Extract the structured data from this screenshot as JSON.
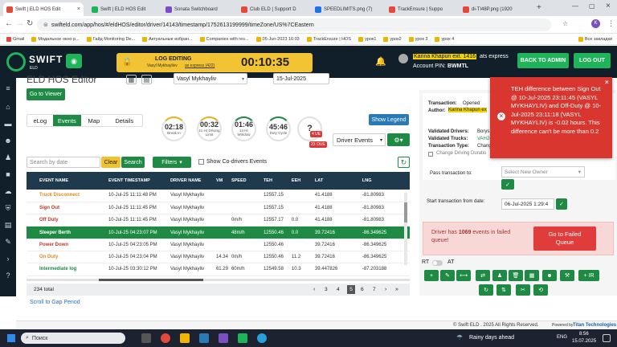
{
  "browser": {
    "tabs": [
      {
        "label": "Swift | ELD HOS Edit",
        "color": "#e24b3b",
        "active": true
      },
      {
        "label": "Swift | ELD HOS Edit",
        "color": "#1fb35a"
      },
      {
        "label": "Sonata Switchboard",
        "color": "#7b4bc9"
      },
      {
        "label": "Club ELD | Support D",
        "color": "#e24b3b"
      },
      {
        "label": "SPEEDLIMITS.png (7)",
        "color": "#1a73e8"
      },
      {
        "label": "TrackEnsure | Suppo",
        "color": "#e24b3b"
      },
      {
        "label": "di-TI48P.png (1920",
        "color": "#e24b3b"
      }
    ],
    "url": "swifteld.com/app/hos/#/eldHOS/editor/driver/14143/timestamp/1752613199999/timeZone/US%7CEastern",
    "bookmarks": [
      "Gmail",
      "Модальное окно р...",
      "Гайд Monitoring De...",
      "Актуальные избран...",
      "Companies with res...",
      "05-Jun-2023 16:03",
      "TrackEnsure | HOS",
      "урок1",
      "урок2",
      "урок 3",
      "урок 4",
      "Все закладки"
    ]
  },
  "header": {
    "brand": "SWIFT",
    "brand_sub": "ELD",
    "log_editing_title": "LOG EDITING",
    "log_editing_sub": "Vasyl Mykhaylivv",
    "log_editing_as": "as express (422)",
    "timer": "00:10:35",
    "user_name": "Karina Khapun ext. 1416",
    "user_company": "ats express",
    "account_pin_label": "Account PIN:",
    "account_pin": "BWMTL",
    "back_to_admin": "BACK TO ADMIN",
    "logout": "LOG OUT"
  },
  "editor": {
    "title": "ELD HOS Editor",
    "driver": "Vasyl Mykhayliv",
    "date": "15-Jul-2025",
    "go_to_viewer": "Go to Viewer",
    "tabs": [
      "eLog",
      "Events",
      "Map",
      "Details"
    ],
    "active_tab": "Events",
    "show_legend": "Show Legend",
    "gauges": [
      {
        "value": "02:18",
        "label": "Break In"
      },
      {
        "value": "00:32",
        "label": "11 Hr Driving Limit"
      },
      {
        "value": "01:46",
        "label": "14 Hr Window"
      },
      {
        "value": "45:46",
        "label": "Duty Cycle"
      },
      {
        "value": "?",
        "label": ""
      }
    ],
    "badge_ue": "4 UE",
    "badge_oue": "23 OUE",
    "driver_events": "Driver Events",
    "search_placeholder": "Search by date",
    "clear": "Clear",
    "search": "Search",
    "filters": "Filters",
    "show_codrivers": "Show Co-drivers Events",
    "columns": [
      "EVENT NAME",
      "EVENT TIMESTAMP",
      "DRIVER NAME",
      "VM",
      "SPEED",
      "TEH",
      "EEH",
      "LAT",
      "LNG"
    ],
    "rows": [
      {
        "event": "Truck Disconnect",
        "color": "#e08a1e",
        "ts": "10-Jul-25 11:11:48 PM",
        "driver": "Vasyl Mykhayliv",
        "vm": "",
        "speed": "",
        "teh": "12557.15",
        "eeh": "",
        "lat": "41.4188",
        "lng": "-81.80983"
      },
      {
        "event": "Sign Out",
        "color": "#c0392b",
        "ts": "10-Jul-25 11:11:45 PM",
        "driver": "Vasyl Mykhayliv",
        "vm": "",
        "speed": "",
        "teh": "12557.15",
        "eeh": "",
        "lat": "41.4188",
        "lng": "-81.80983"
      },
      {
        "event": "Off Duty",
        "color": "#c0392b",
        "ts": "10-Jul-25 11:11:45 PM",
        "driver": "Vasyl Mykhayliv",
        "vm": "",
        "speed": "0m/h",
        "teh": "12557.17",
        "eeh": "0.0",
        "lat": "41.4188",
        "lng": "-81.80983"
      },
      {
        "event": "Sleeper Berth",
        "color": "#ffffff",
        "ts": "10-Jul-25 04:23:07 PM",
        "driver": "Vasyl Mykhayliv",
        "vm": "",
        "speed": "48m/h",
        "teh": "12550.46",
        "eeh": "0.0",
        "lat": "39.72416",
        "lng": "-86.349625",
        "selected": true
      },
      {
        "event": "Power Down",
        "color": "#c0392b",
        "ts": "10-Jul-25 04:23:05 PM",
        "driver": "Vasyl Mykhayliv",
        "vm": "",
        "speed": "",
        "teh": "12550.46",
        "eeh": "",
        "lat": "39.72416",
        "lng": "-86.349625"
      },
      {
        "event": "On Duty",
        "color": "#e08a1e",
        "ts": "10-Jul-25 04:23:04 PM",
        "driver": "Vasyl Mykhayliv",
        "vm": "14.34",
        "speed": "0m/h",
        "teh": "12550.46",
        "eeh": "11.2",
        "lat": "39.72416",
        "lng": "-86.349625"
      },
      {
        "event": "Intermediate log",
        "color": "#1e8a44",
        "ts": "10-Jul-25 03:30:12 PM",
        "driver": "Vasyl Mykhayliv",
        "vm": "61.29",
        "speed": "60m/h",
        "teh": "12549.58",
        "eeh": "10.3",
        "lat": "39.447826",
        "lng": "-87.203188"
      }
    ],
    "total": "234 total",
    "pages": [
      "3",
      "4",
      "5",
      "6",
      "7"
    ],
    "current_page": "5",
    "scroll_to_gap": "Scroll to Gap Period"
  },
  "error_popup": {
    "message": "TEH difference between Sign Out @ 10-Jul-2025 23:11:45 (VASYL MYKHAYLIV) and Off-Duty @ 10-Jul-2025 23:11:18 (VASYL MYKHAYLIV) is -0.02 hours. This difference can't be more than 0.2"
  },
  "transaction": {
    "status_label": "Transaction:",
    "status": "Opened",
    "author_label": "Author:",
    "author": "Karina Khapun ex",
    "validated_drivers_label": "Validated Drivers:",
    "validated_drivers": "Borys",
    "validated_trucks_label": "Validated Trucks:",
    "validated_trucks": "VAH24",
    "transaction_type_label": "Transaction Type:",
    "transaction_type": "Chang",
    "change_duration": "Change Driving Duratio",
    "pass_label": "Pass transaction to:",
    "owner_placeholder": "Select New Owner",
    "start_label": "Start transaction from date:",
    "start_date": "06-Jul-2025 1:29:4",
    "queue_prefix": "Driver has",
    "queue_count": "1069",
    "queue_suffix": "events in failed queue!",
    "go_to_failed": "Go to Failed Queue",
    "rt": "RT",
    "at": "AT",
    "ir": "+ IR"
  },
  "footer": {
    "copyright": "© Swift ELD . 2025 All Rights Reserved.",
    "powered": "Powered by",
    "titan": "Titan Technologies"
  },
  "taskbar": {
    "search": "Поиск",
    "weather": "Rainy days ahead",
    "lang": "ENG",
    "time": "8:56",
    "date": "15.07.2025"
  }
}
